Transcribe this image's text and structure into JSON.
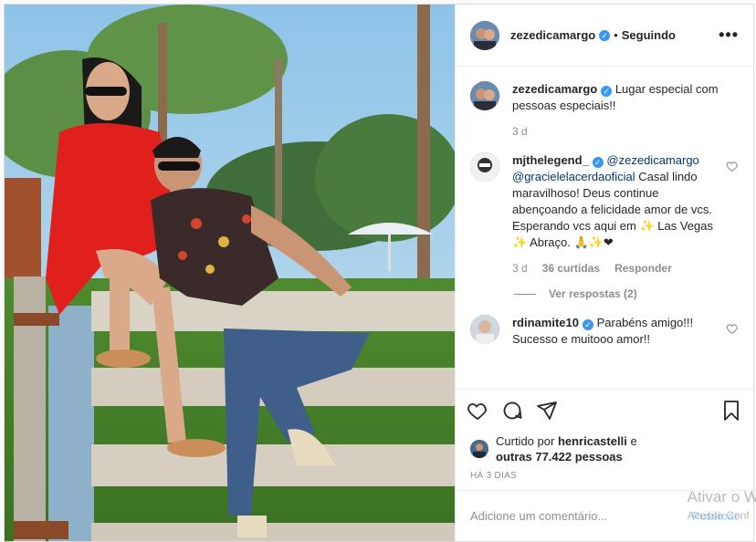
{
  "post": {
    "author": "zezedicamargo",
    "follow_status": "Seguindo",
    "separator": "•",
    "more_label": "•••"
  },
  "caption": {
    "author": "zezedicamargo",
    "text": "Lugar especial com pessoas especiais!!",
    "time": "3 d"
  },
  "comments": [
    {
      "author": "mjthelegend_",
      "mention1": "@zezedicamargo",
      "mention2": "@gracielelacerdaoficial",
      "text": "Casal lindo maravilhoso! Deus continue abençoando a felicidade amor de vcs. Esperando vcs aqui em ✨ Las Vegas ✨ Abraço. 🙏✨❤",
      "time": "3 d",
      "likes": "36 curtidas",
      "reply": "Responder",
      "view_replies": "Ver respostas (2)"
    },
    {
      "author": "rdinamite10",
      "text": "Parabéns amigo!!! Sucesso e muitooo amor!!"
    }
  ],
  "likes": {
    "prefix": "Curtido por",
    "user": "henricastelli",
    "and": "e",
    "others": "outras 77.422 pessoas"
  },
  "date": "HÁ 3 DIAS",
  "add_comment": {
    "placeholder": "Adicione um comentário...",
    "publish": "Publicar"
  },
  "watermark": {
    "line1": "Ativar o W",
    "line2": "Acesse Conf"
  },
  "icons": {
    "like": "heart-icon",
    "comment": "comment-icon",
    "share": "share-icon",
    "save": "bookmark-icon"
  },
  "colors": {
    "verified": "#3897f0",
    "mention": "#00376b",
    "muted": "#8e8e8e"
  }
}
